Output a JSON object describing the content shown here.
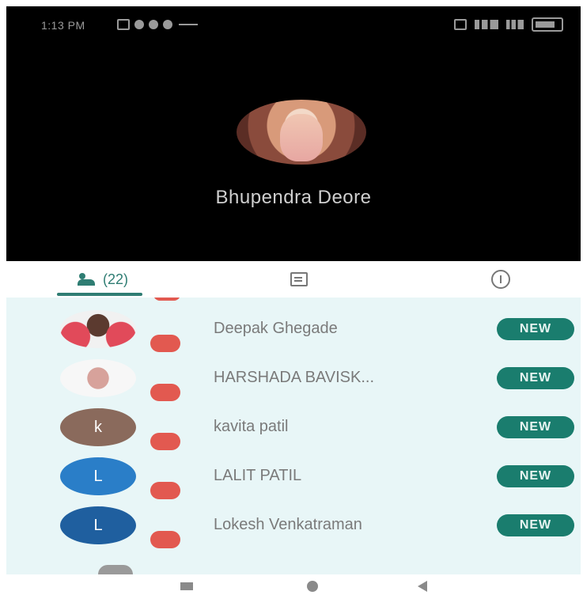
{
  "status_bar": {
    "time": "1:13 PM",
    "left_icons": [
      "message-icon",
      "whatsapp-icon",
      "google-meet-icon",
      "settings-icon",
      "dots-icon"
    ],
    "right_icons": [
      "vibrate-icon",
      "signal-icon",
      "wifi-icon",
      "battery-icon"
    ]
  },
  "call": {
    "caller_name": "Bhupendra Deore"
  },
  "tabs": {
    "people_count": "(22)",
    "people_icon": "people-icon",
    "chat_icon": "chat-icon",
    "info_icon": "info-icon"
  },
  "participants": [
    {
      "name": "Deepak Ghegade",
      "initial": "",
      "badge": "",
      "status": "NEW"
    },
    {
      "name": "HARSHADA BAVISK...",
      "initial": "",
      "badge": "",
      "status": "NEW"
    },
    {
      "name": "kavita patil",
      "initial": "k",
      "badge": "",
      "status": "NEW"
    },
    {
      "name": "LALIT PATIL",
      "initial": "L",
      "badge": "",
      "status": "NEW"
    },
    {
      "name": "Lokesh Venkatraman",
      "initial": "L",
      "badge": "",
      "status": "NEW"
    }
  ],
  "colors": {
    "accent": "#1a7d6e",
    "list_bg": "#e8f6f7",
    "badge": "#e25950"
  },
  "nav": {
    "icons": [
      "recent-apps-icon",
      "home-icon",
      "back-icon"
    ]
  }
}
